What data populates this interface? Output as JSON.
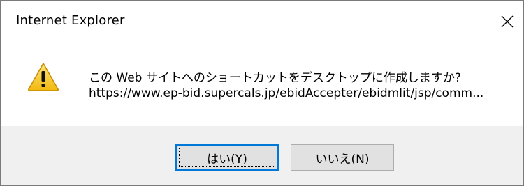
{
  "window": {
    "title": "Internet Explorer",
    "close_glyph": "✕"
  },
  "message": {
    "line1": "この Web サイトへのショートカットをデスクトップに作成しますか?",
    "line2": "https://www.ep-bid.supercals.jp/ebidAccepter/ebidmlit/jsp/comm..."
  },
  "buttons": {
    "yes": {
      "prefix": "はい(",
      "mnemonic": "Y",
      "suffix": ")"
    },
    "no": {
      "prefix": "いいえ(",
      "mnemonic": "N",
      "suffix": ")"
    }
  },
  "icons": {
    "warning": "warning-icon",
    "close": "close-icon"
  },
  "colors": {
    "footer_bg": "#f0f0f0",
    "button_bg": "#e1e1e1",
    "default_button_border": "#0078d7",
    "warning_yellow": "#f5c518"
  }
}
